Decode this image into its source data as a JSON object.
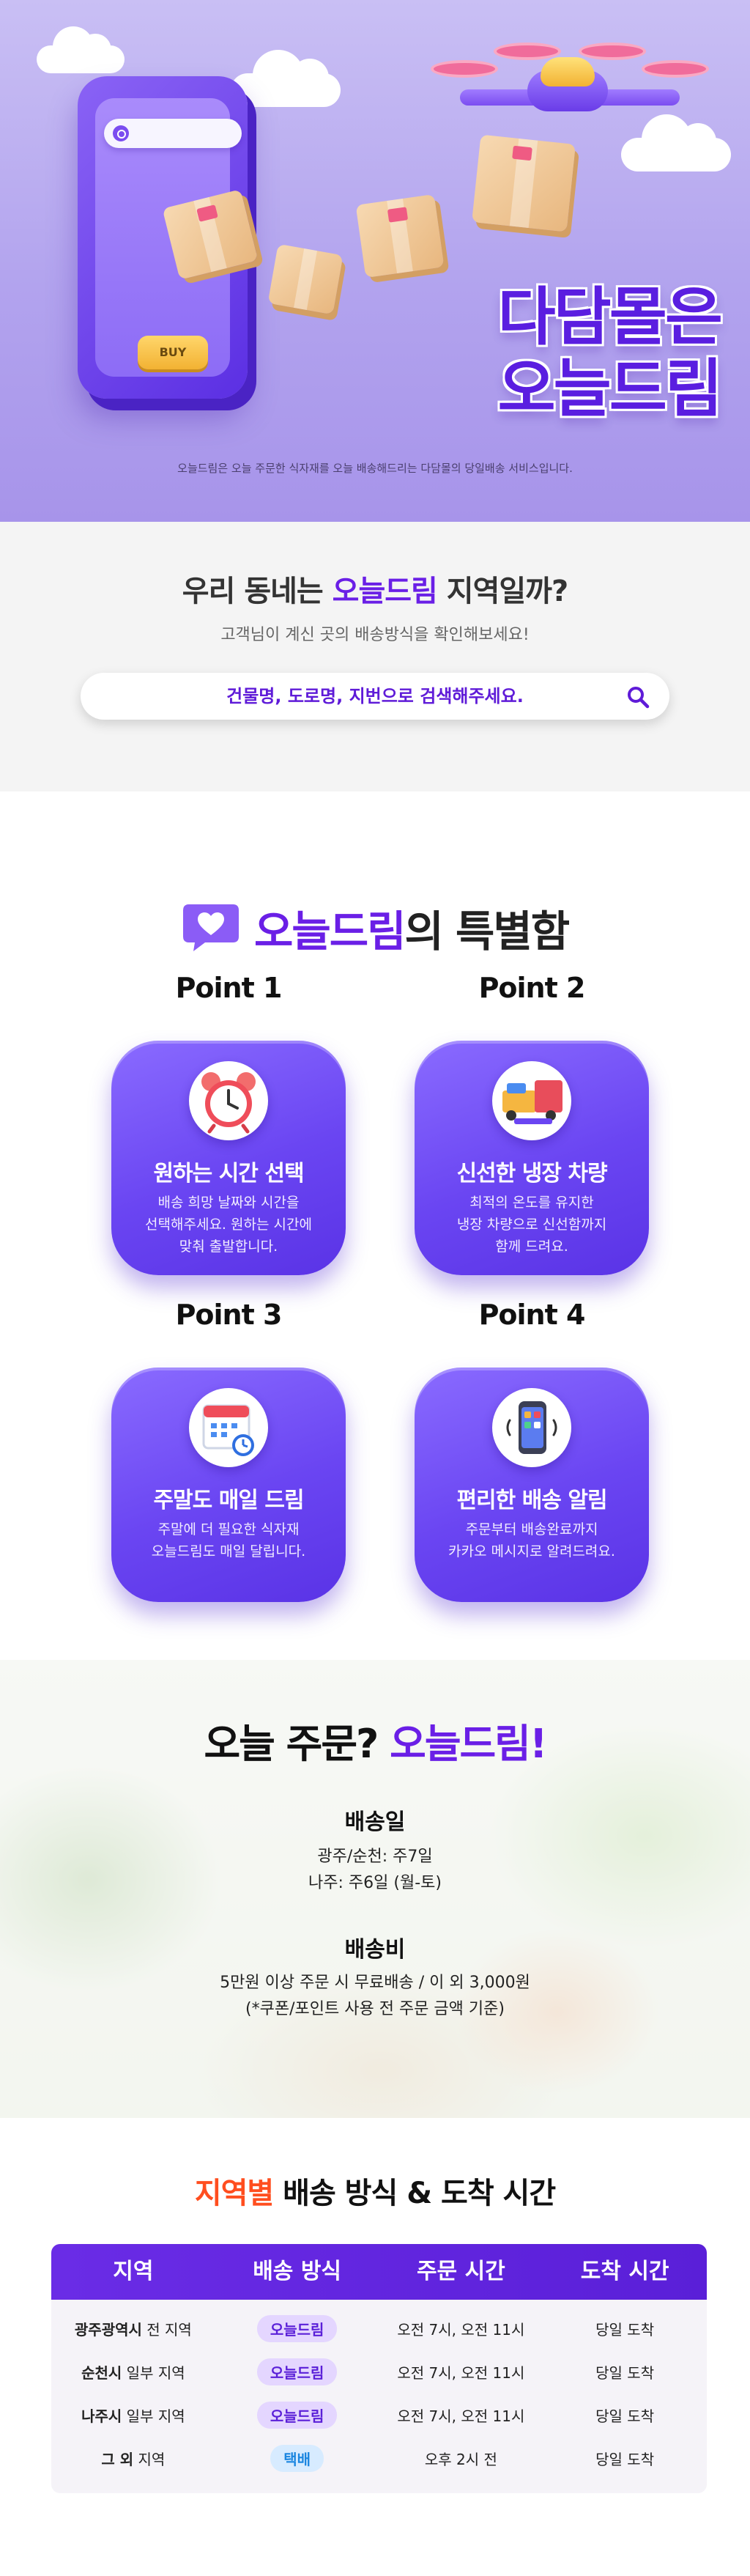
{
  "hero": {
    "buy_label": "BUY",
    "title_line1": "다담몰은",
    "title_line2": "오늘드림",
    "desc": "오늘드림은 오늘 주문한 식자재를 오늘 배송해드리는 다담몰의 당일배송 서비스입니다."
  },
  "search": {
    "title_prefix": "우리 동네는 ",
    "title_highlight": "오늘드림",
    "title_suffix": " 지역일까?",
    "subtitle": "고객님이 계신 곳의 배송방식을 확인해보세요!",
    "placeholder": "건물명, 도로명, 지번으로 검색해주세요."
  },
  "special": {
    "title_highlight": "오늘드림",
    "title_suffix": "의 특별함",
    "points": [
      {
        "label": "Point 1",
        "icon": "alarm-clock-icon",
        "title": "원하는 시간 선택",
        "desc": "배송 희망 날짜와 시간을\n선택해주세요. 원하는 시간에\n맞춰 출발합니다."
      },
      {
        "label": "Point 2",
        "icon": "refrigerated-truck-icon",
        "title": "신선한 냉장 차량",
        "desc": "최적의 온도를 유지한\n냉장 차량으로 신선함까지\n함께 드려요."
      },
      {
        "label": "Point 3",
        "icon": "calendar-icon",
        "title": "주말도 매일 드림",
        "desc": "주말에 더 필요한 식자재\n오늘드림도 매일 달립니다."
      },
      {
        "label": "Point 4",
        "icon": "smartphone-icon",
        "title": "편리한 배송 알림",
        "desc": "주문부터 배송완료까지\n카카오 메시지로 알려드려요."
      }
    ]
  },
  "order": {
    "title_prefix": "오늘 주문? ",
    "title_highlight": "오늘드림!",
    "delivery_day_label": "배송일",
    "delivery_day_line1": "광주/순천: 주7일",
    "delivery_day_line2": "나주: 주6일 (월-토)",
    "fee_label": "배송비",
    "fee_line1": "5만원 이상 주문 시 무료배송 / 이 외 3,000원",
    "fee_line2": "(*쿠폰/포인트 사용 전 주문 금액 기준)"
  },
  "region": {
    "title_highlight": "지역별",
    "title_suffix": " 배송 방식 & 도착 시간",
    "headers": [
      "지역",
      "배송 방식",
      "주문 시간",
      "도착 시간"
    ],
    "rows": [
      {
        "area_strong": "광주광역시",
        "area_rest": " 전 지역",
        "method": "오늘드림",
        "method_style": "purple",
        "order_time": "오전 7시, 오전 11시",
        "arrival": "당일 도착"
      },
      {
        "area_strong": "순천시",
        "area_rest": " 일부 지역",
        "method": "오늘드림",
        "method_style": "purple",
        "order_time": "오전 7시, 오전 11시",
        "arrival": "당일 도착"
      },
      {
        "area_strong": "나주시",
        "area_rest": " 일부 지역",
        "method": "오늘드림",
        "method_style": "purple",
        "order_time": "오전 7시, 오전 11시",
        "arrival": "당일 도착"
      },
      {
        "area_strong": "그 외",
        "area_rest": " 지역",
        "method": "택배",
        "method_style": "blue",
        "order_time": "오후 2시 전",
        "arrival": "당일 도착"
      }
    ]
  },
  "colors": {
    "brand_purple": "#6a1fe6",
    "accent_orange": "#ff4e1f",
    "card_purple": "#6a45f2",
    "parcel_blue": "#1b86e0"
  }
}
